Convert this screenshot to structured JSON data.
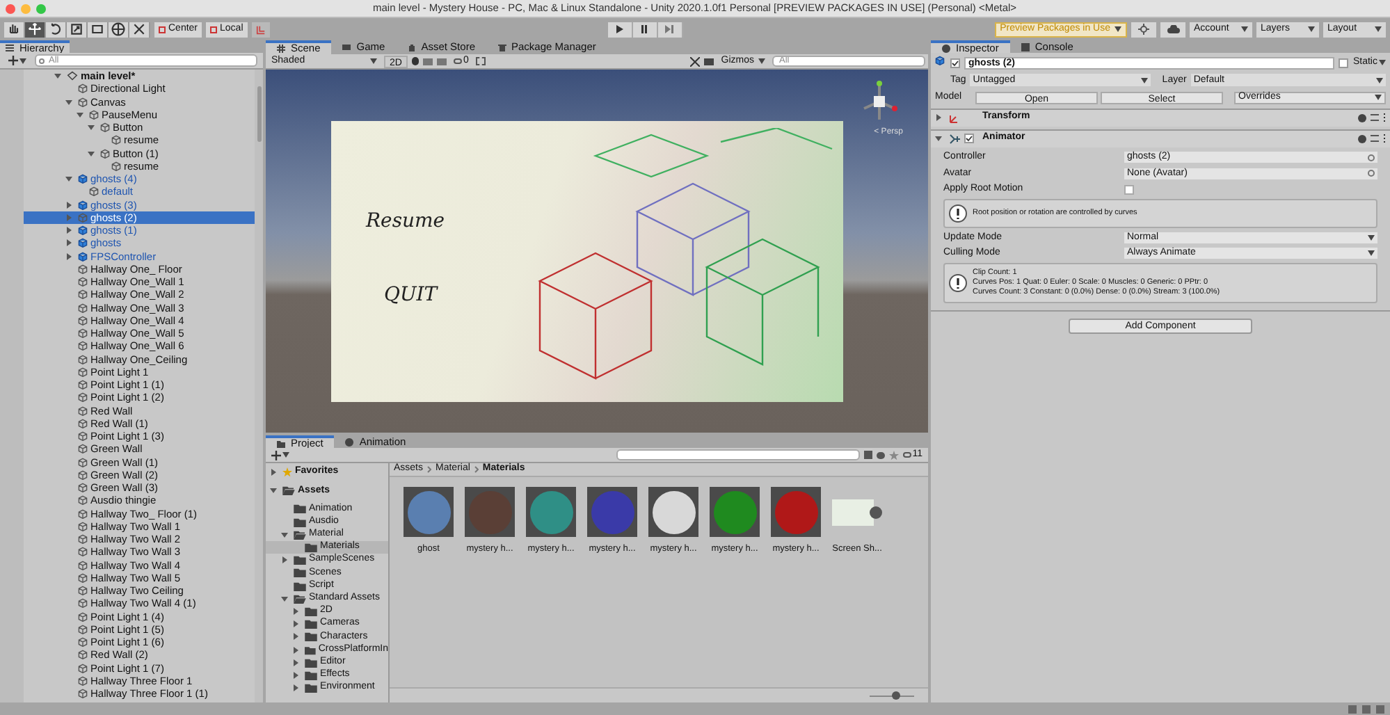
{
  "window": {
    "title": "main level - Mystery House - PC, Mac & Linux Standalone - Unity 2020.1.0f1 Personal [PREVIEW PACKAGES IN USE] (Personal) <Metal>"
  },
  "toolbar": {
    "tools": [
      {
        "kind": "hand",
        "selected": false
      },
      {
        "kind": "move",
        "selected": true
      },
      {
        "kind": "rotate",
        "selected": false
      },
      {
        "kind": "scale",
        "selected": false
      },
      {
        "kind": "rect",
        "selected": false
      },
      {
        "kind": "transform",
        "selected": false
      },
      {
        "kind": "custom",
        "selected": false
      }
    ],
    "pivot": [
      "Center",
      "Local"
    ],
    "preview_packages": "Preview Packages in Use",
    "menus": [
      "Account",
      "Layers",
      "Layout"
    ]
  },
  "hierarchy": {
    "tab": "Hierarchy",
    "search_placeholder": "All",
    "items": [
      {
        "label": "main level*",
        "kind": "scene",
        "selected": false,
        "expanded": true,
        "children": [
          {
            "label": "Directional Light",
            "kind": "object",
            "selected": false
          },
          {
            "label": "Canvas",
            "kind": "object",
            "selected": false,
            "expanded": true,
            "children": [
              {
                "label": "PauseMenu",
                "kind": "object",
                "selected": false,
                "expanded": true,
                "children": [
                  {
                    "label": "Button",
                    "kind": "object",
                    "selected": false,
                    "expanded": true,
                    "children": [
                      {
                        "label": "resume",
                        "kind": "object",
                        "selected": false
                      }
                    ]
                  },
                  {
                    "label": "Button (1)",
                    "kind": "object",
                    "selected": false,
                    "expanded": true,
                    "children": [
                      {
                        "label": "resume",
                        "kind": "object",
                        "selected": false
                      }
                    ]
                  }
                ]
              }
            ]
          },
          {
            "label": "ghosts (4)",
            "kind": "prefab",
            "selected": false,
            "expanded": true,
            "children": [
              {
                "label": "default",
                "kind": "prefab-part",
                "selected": false
              }
            ]
          },
          {
            "label": "ghosts (3)",
            "kind": "prefab",
            "selected": false,
            "expanded": false
          },
          {
            "label": "ghosts (2)",
            "kind": "prefab",
            "selected": true,
            "expanded": false
          },
          {
            "label": "ghosts (1)",
            "kind": "prefab",
            "selected": false,
            "expanded": false
          },
          {
            "label": "ghosts",
            "kind": "prefab",
            "selected": false,
            "expanded": false
          },
          {
            "label": "FPSController",
            "kind": "prefab",
            "selected": false,
            "expanded": false
          },
          {
            "label": "Hallway One_ Floor",
            "kind": "object",
            "selected": false
          },
          {
            "label": "Hallway One_Wall 1",
            "kind": "object",
            "selected": false
          },
          {
            "label": "Hallway One_Wall 2",
            "kind": "object",
            "selected": false
          },
          {
            "label": "Hallway One_Wall 3",
            "kind": "object",
            "selected": false
          },
          {
            "label": "Hallway One_Wall 4",
            "kind": "object",
            "selected": false
          },
          {
            "label": "Hallway One_Wall 5",
            "kind": "object",
            "selected": false
          },
          {
            "label": "Hallway One_Wall 6",
            "kind": "object",
            "selected": false
          },
          {
            "label": "Hallway One_Ceiling",
            "kind": "object",
            "selected": false
          },
          {
            "label": "Point Light 1",
            "kind": "object",
            "selected": false
          },
          {
            "label": "Point Light 1 (1)",
            "kind": "object",
            "selected": false
          },
          {
            "label": "Point Light 1 (2)",
            "kind": "object",
            "selected": false
          },
          {
            "label": "Red Wall",
            "kind": "object",
            "selected": false
          },
          {
            "label": "Red Wall (1)",
            "kind": "object",
            "selected": false
          },
          {
            "label": "Point Light 1 (3)",
            "kind": "object",
            "selected": false
          },
          {
            "label": "Green Wall",
            "kind": "object",
            "selected": false
          },
          {
            "label": "Green Wall (1)",
            "kind": "object",
            "selected": false
          },
          {
            "label": "Green Wall (2)",
            "kind": "object",
            "selected": false
          },
          {
            "label": "Green Wall (3)",
            "kind": "object",
            "selected": false
          },
          {
            "label": "Ausdio thingie",
            "kind": "object",
            "selected": false
          },
          {
            "label": "Hallway Two_ Floor (1)",
            "kind": "object",
            "selected": false
          },
          {
            "label": "Hallway Two Wall 1",
            "kind": "object",
            "selected": false
          },
          {
            "label": "Hallway Two Wall 2",
            "kind": "object",
            "selected": false
          },
          {
            "label": "Hallway Two Wall 3",
            "kind": "object",
            "selected": false
          },
          {
            "label": "Hallway Two Wall 4",
            "kind": "object",
            "selected": false
          },
          {
            "label": "Hallway Two Wall 5",
            "kind": "object",
            "selected": false
          },
          {
            "label": "Hallway Two Ceiling",
            "kind": "object",
            "selected": false
          },
          {
            "label": "Hallway Two Wall 4 (1)",
            "kind": "object",
            "selected": false
          },
          {
            "label": "Point Light 1 (4)",
            "kind": "object",
            "selected": false
          },
          {
            "label": "Point Light 1 (5)",
            "kind": "object",
            "selected": false
          },
          {
            "label": "Point Light 1 (6)",
            "kind": "object",
            "selected": false
          },
          {
            "label": "Red Wall (2)",
            "kind": "object",
            "selected": false
          },
          {
            "label": "Point Light 1 (7)",
            "kind": "object",
            "selected": false
          },
          {
            "label": "Hallway Three Floor 1",
            "kind": "object",
            "selected": false
          },
          {
            "label": "Hallway Three Floor 1 (1)",
            "kind": "object",
            "selected": false
          }
        ]
      }
    ]
  },
  "scene": {
    "tabs": [
      {
        "label": "Scene",
        "kind": "scene",
        "selected": true
      },
      {
        "label": "Game",
        "kind": "game",
        "selected": false
      },
      {
        "label": "Asset Store",
        "kind": "store",
        "selected": false
      },
      {
        "label": "Package Manager",
        "kind": "package",
        "selected": false
      }
    ],
    "shading": "Shaded",
    "mode_2d": "2D",
    "hidden_count": "0",
    "gizmos": "Gizmos",
    "search_placeholder": "All",
    "projection": "< Persp",
    "canvas_texts": [
      "Resume",
      "QUIT"
    ]
  },
  "project": {
    "tabs": [
      {
        "label": "Project",
        "kind": "project",
        "selected": true
      },
      {
        "label": "Animation",
        "kind": "animation",
        "selected": false
      }
    ],
    "hidden_count": "11",
    "folders": [
      {
        "label": "Favorites",
        "kind": "favorites",
        "selected": false,
        "expanded": false
      },
      {
        "label": "Assets",
        "kind": "root",
        "selected": false,
        "expanded": true,
        "children": [
          {
            "label": "Animation",
            "kind": "folder",
            "selected": false
          },
          {
            "label": "Ausdio",
            "kind": "folder",
            "selected": false
          },
          {
            "label": "Material",
            "kind": "folder",
            "selected": false,
            "expanded": true,
            "children": [
              {
                "label": "Materials",
                "kind": "folder",
                "selected": true
              }
            ]
          },
          {
            "label": "SampleScenes",
            "kind": "folder",
            "selected": false,
            "expanded": false
          },
          {
            "label": "Scenes",
            "kind": "folder",
            "selected": false
          },
          {
            "label": "Script",
            "kind": "folder",
            "selected": false
          },
          {
            "label": "Standard Assets",
            "kind": "folder",
            "selected": false,
            "expanded": true,
            "children": [
              {
                "label": "2D",
                "kind": "folder",
                "selected": false,
                "expanded": false
              },
              {
                "label": "Cameras",
                "kind": "folder",
                "selected": false,
                "expanded": false
              },
              {
                "label": "Characters",
                "kind": "folder",
                "selected": false,
                "expanded": false
              },
              {
                "label": "CrossPlatformIn",
                "kind": "folder",
                "selected": false,
                "expanded": false
              },
              {
                "label": "Editor",
                "kind": "folder",
                "selected": false,
                "expanded": false
              },
              {
                "label": "Effects",
                "kind": "folder",
                "selected": false,
                "expanded": false
              },
              {
                "label": "Environment",
                "kind": "folder",
                "selected": false,
                "expanded": false
              }
            ]
          }
        ]
      }
    ],
    "breadcrumb": [
      "Assets",
      "Material",
      "Materials"
    ],
    "assets": [
      {
        "label": "ghost",
        "kind": "material",
        "color": "#5a7fb0"
      },
      {
        "label": "mystery h...",
        "kind": "material",
        "color": "#5a3f36"
      },
      {
        "label": "mystery h...",
        "kind": "material",
        "color": "#2f8f86"
      },
      {
        "label": "mystery h...",
        "kind": "material",
        "color": "#3a3aa8"
      },
      {
        "label": "mystery h...",
        "kind": "material",
        "color": "#d8d8d8"
      },
      {
        "label": "mystery h...",
        "kind": "material",
        "color": "#1f8a1f"
      },
      {
        "label": "mystery h...",
        "kind": "material",
        "color": "#b01818"
      },
      {
        "label": "Screen Sh...",
        "kind": "image",
        "color": "#e8efe4"
      }
    ],
    "icon_size": {
      "level": 0.6
    }
  },
  "inspector": {
    "tabs": [
      {
        "label": "Inspector",
        "kind": "info",
        "selected": true
      },
      {
        "label": "Console",
        "kind": "console",
        "selected": false
      }
    ],
    "object": {
      "active": true,
      "name": "ghosts (2)",
      "static_label": "Static",
      "static": false,
      "tag_label": "Tag",
      "tag": "Untagged",
      "layer_label": "Layer",
      "layer": "Default",
      "model_label": "Model",
      "model_buttons": [
        "Open",
        "Select"
      ],
      "overrides": "Overrides"
    },
    "components": [
      {
        "name": "Transform",
        "kind": "transform",
        "expanded": false
      },
      {
        "name": "Animator",
        "kind": "animator",
        "expanded": true,
        "enabled": true,
        "fields": [
          {
            "label": "Controller",
            "kind": "object",
            "value": "ghosts (2)"
          },
          {
            "label": "Avatar",
            "kind": "object",
            "value": "None (Avatar)"
          },
          {
            "label": "Apply Root Motion",
            "kind": "checkbox",
            "checked": false
          },
          {
            "kind": "help",
            "lines": [
              "Root position or rotation are controlled by curves"
            ]
          },
          {
            "label": "Update Mode",
            "kind": "dropdown",
            "value": "Normal"
          },
          {
            "label": "Culling Mode",
            "kind": "dropdown",
            "value": "Always Animate"
          },
          {
            "kind": "help",
            "lines": [
              "Clip Count: 1",
              "Curves Pos: 1 Quat: 0 Euler: 0 Scale: 0 Muscles: 0 Generic: 0 PPtr: 0",
              "Curves Count: 3 Constant: 0 (0.0%) Dense: 0 (0.0%) Stream: 3 (100.0%)"
            ]
          }
        ]
      }
    ],
    "add_component": "Add Component"
  }
}
